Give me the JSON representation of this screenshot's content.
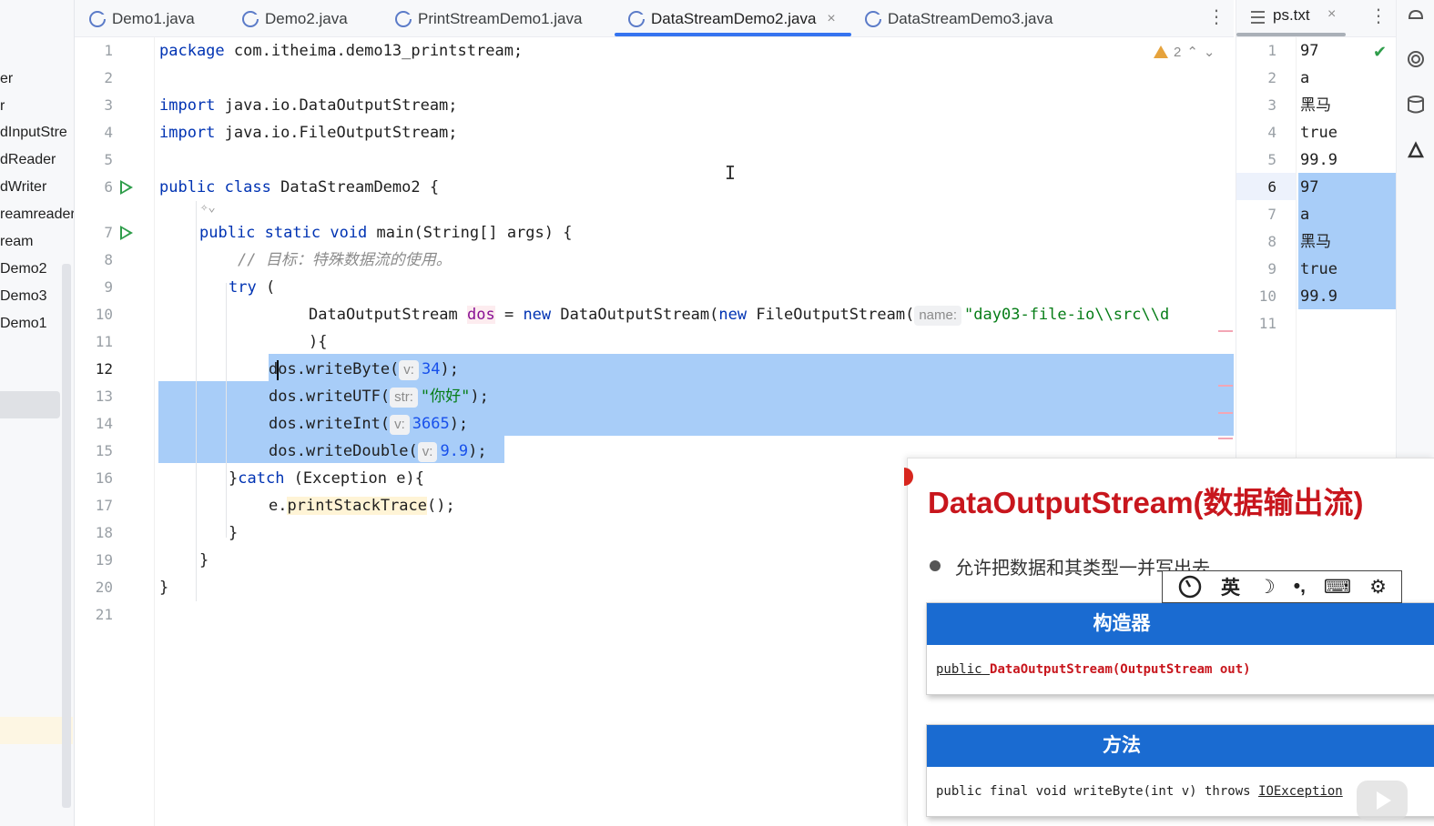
{
  "project_panel": {
    "items": [
      "er",
      "r",
      "dInputStre",
      "dReader",
      "dWriter",
      "reamreader",
      "ream",
      "Demo2",
      "Demo3",
      "Demo1"
    ]
  },
  "tabs": [
    {
      "label": "Demo1.java",
      "active": false
    },
    {
      "label": "Demo2.java",
      "active": false
    },
    {
      "label": "PrintStreamDemo1.java",
      "active": false
    },
    {
      "label": "DataStreamDemo2.java",
      "active": true,
      "close": "×"
    },
    {
      "label": "DataStreamDemo3.java",
      "active": false
    }
  ],
  "kebab": "⋮",
  "editor": {
    "warnings_count": "2",
    "line_numbers": [
      "1",
      "2",
      "3",
      "4",
      "5",
      "6",
      "7",
      "8",
      "9",
      "10",
      "11",
      "12",
      "13",
      "14",
      "15",
      "16",
      "17",
      "18",
      "19",
      "20",
      "21"
    ],
    "current_line": "12",
    "code": {
      "l1_kw": "package",
      "l1_rest": " com.itheima.demo13_printstream;",
      "l3_kw": "import",
      "l3_rest": " java.io.DataOutputStream;",
      "l4_kw": "import",
      "l4_rest": " java.io.FileOutputStream;",
      "l6_kw1": "public",
      "l6_kw2": "class",
      "l6_rest": " DataStreamDemo2 {",
      "l7_kw1": "public",
      "l7_kw2": "static",
      "l7_kw3": "void",
      "l7_rest": " main(String[] args) {",
      "l8_comment": "// 目标：特殊数据流的使用。",
      "l9_kw": "try",
      "l9_rest": " (",
      "l10_type": "DataOutputStream ",
      "l10_var": "dos",
      "l10_eq": " = ",
      "l10_new": "new",
      "l10_mid": " DataOutputStream(",
      "l10_new2": "new",
      "l10_mid2": " FileOutputStream(",
      "l10_hint": "name:",
      "l10_str": "\"day03-file-io\\\\src\\\\d",
      "l11": "){",
      "l12_pre": "dos.writeByte(",
      "l12_hint": "v:",
      "l12_num": "34",
      "l12_post": ");",
      "l13_pre": "dos.writeUTF(",
      "l13_hint": "str:",
      "l13_str": "\"你好\"",
      "l13_post": ");",
      "l14_pre": "dos.writeInt(",
      "l14_hint": "v:",
      "l14_num": "3665",
      "l14_post": ");",
      "l15_pre": "dos.writeDouble(",
      "l15_hint": "v:",
      "l15_num": "9.9",
      "l15_post": ");",
      "l16_pre": "}",
      "l16_kw": "catch",
      "l16_rest": " (Exception e){",
      "l17_pre": "e.",
      "l17_mth": "printStackTrace",
      "l17_post": "();",
      "l18": "}",
      "l19": "}",
      "l20": "}"
    }
  },
  "ps_txt": {
    "tab_label": "ps.txt",
    "close": "×",
    "line_numbers": [
      "1",
      "2",
      "3",
      "4",
      "5",
      "6",
      "7",
      "8",
      "9",
      "10",
      "11"
    ],
    "lines": [
      "97",
      "a",
      "黑马",
      "true",
      "99.9",
      "97",
      "a",
      "黑马",
      "true",
      "99.9",
      ""
    ]
  },
  "slide": {
    "title": "DataOutputStream(数据输出流)",
    "bullet": "允许把数据和其类型一并写出去",
    "constructor_header": "构造器",
    "constructor_sig_pre": "public ",
    "constructor_sig_red": "DataOutputStream(OutputStream out)",
    "methods_header": "方法",
    "method_sig": "public final void writeByte(int v) throws ",
    "method_exc": "IOException"
  },
  "ime": {
    "lang": "英",
    "moon": "☽",
    "punct": "•,",
    "keyboard": "⌨",
    "gear": "⚙"
  },
  "colors": {
    "accent": "#3574f0",
    "keyword": "#0033b3",
    "string": "#067d17",
    "number": "#1750eb",
    "selection": "#a8cdf8",
    "slide_title": "#c8161d",
    "slide_header": "#1a6bd1"
  }
}
